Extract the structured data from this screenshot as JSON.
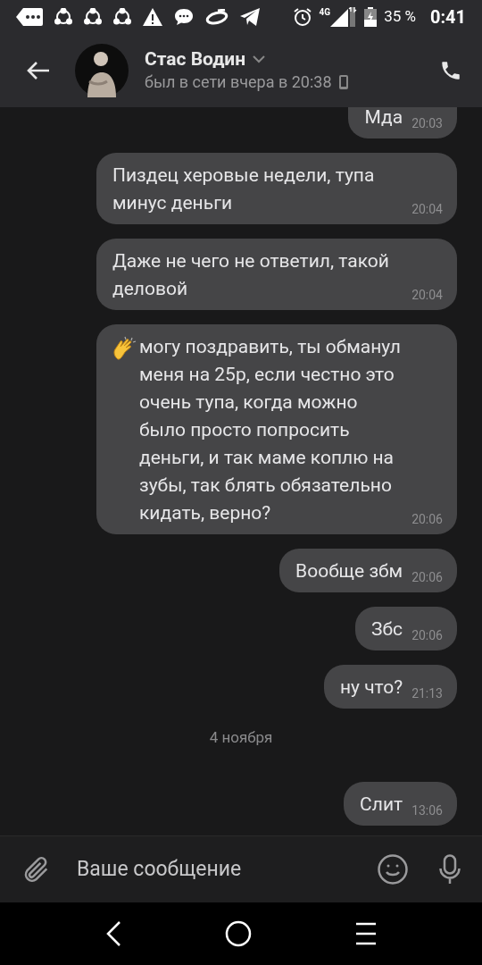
{
  "status_bar": {
    "network": "4G",
    "battery": "35 %",
    "time": "0:41"
  },
  "header": {
    "name": "Стас Водин",
    "last_seen": "был в сети вчера в 20:38"
  },
  "messages": [
    {
      "kind": "message",
      "text": "Мда",
      "time": "20:03"
    },
    {
      "kind": "message",
      "text": "Пиздец херовые недели, тупа минус деньги",
      "time": "20:04"
    },
    {
      "kind": "message",
      "text": "Даже не чего не ответил, такой деловой",
      "time": "20:04"
    },
    {
      "kind": "clap_message",
      "text": "могу поздравить, ты обманул меня на 25р, если честно это очень тупа, когда можно было просто попросить деньги, и так маме коплю на зубы, так блять обязательно кидать, верно?",
      "time": "20:06"
    },
    {
      "kind": "message",
      "text": "Вообще збм",
      "time": "20:06"
    },
    {
      "kind": "message",
      "text": "Збс",
      "time": "20:06"
    },
    {
      "kind": "message",
      "text": "ну что?",
      "time": "21:13"
    },
    {
      "kind": "date",
      "text": "4 ноября"
    },
    {
      "kind": "message",
      "text": "Слит",
      "time": "13:06"
    }
  ],
  "composer": {
    "placeholder": "Ваше сообщение"
  }
}
